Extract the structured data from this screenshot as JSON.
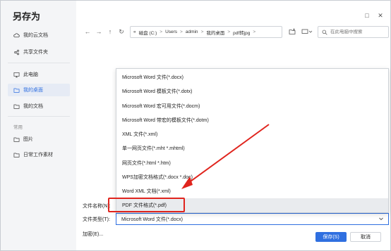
{
  "dialog": {
    "title": "另存为",
    "colors": {
      "accent": "#2f6fe0",
      "highlight_box": "#e0241d",
      "arrow": "#e0241d"
    }
  },
  "sidebar": {
    "items": [
      {
        "label": "我的云文档",
        "icon": "cloud-icon",
        "active": false
      },
      {
        "label": "共享文件夹",
        "icon": "share-icon",
        "active": false
      },
      {
        "label": "此电脑",
        "icon": "computer-icon",
        "active": false
      },
      {
        "label": "我的桌面",
        "icon": "folder-icon",
        "active": true
      },
      {
        "label": "我的文档",
        "icon": "folder-icon",
        "active": false
      }
    ],
    "section_label": "常用",
    "common_items": [
      {
        "label": "图片",
        "icon": "folder-icon"
      },
      {
        "label": "日常工作素材",
        "icon": "folder-icon"
      }
    ]
  },
  "window_controls": {
    "minimize": "□",
    "close": "✕"
  },
  "nav": {
    "back": "←",
    "forward": "→",
    "up": "↑",
    "refresh": "↻",
    "path": [
      "«",
      "磁盘 (C:)",
      "Users",
      "admin",
      "我的桌面",
      "pdf转jpg"
    ],
    "path_sep": ">"
  },
  "search": {
    "placeholder": "在此电脑中搜索"
  },
  "file_type_options": [
    "Microsoft Word 文件(*.docx)",
    "Microsoft Word 模板文件(*.dotx)",
    "Microsoft Word 宏可用文件(*.docm)",
    "Microsoft Word 带宏的模板文件(*.dotm)",
    "XML 文件(*.xml)",
    "单一网页文件(*.mht *.mhtml)",
    "网页文件(*.html *.htm)",
    "WPS加密文档格式(*.docx *.doc)",
    "Word XML 文档(*.xml)",
    "PDF 文件格式(*.pdf)"
  ],
  "form": {
    "filename_label": "文件名称(N):",
    "filetype_label": "文件类型(T):",
    "filetype_value": "Microsoft Word 文件(*.docx)",
    "encrypt_label": "加密(E)..."
  },
  "buttons": {
    "save": "保存(S)",
    "cancel": "取消"
  }
}
